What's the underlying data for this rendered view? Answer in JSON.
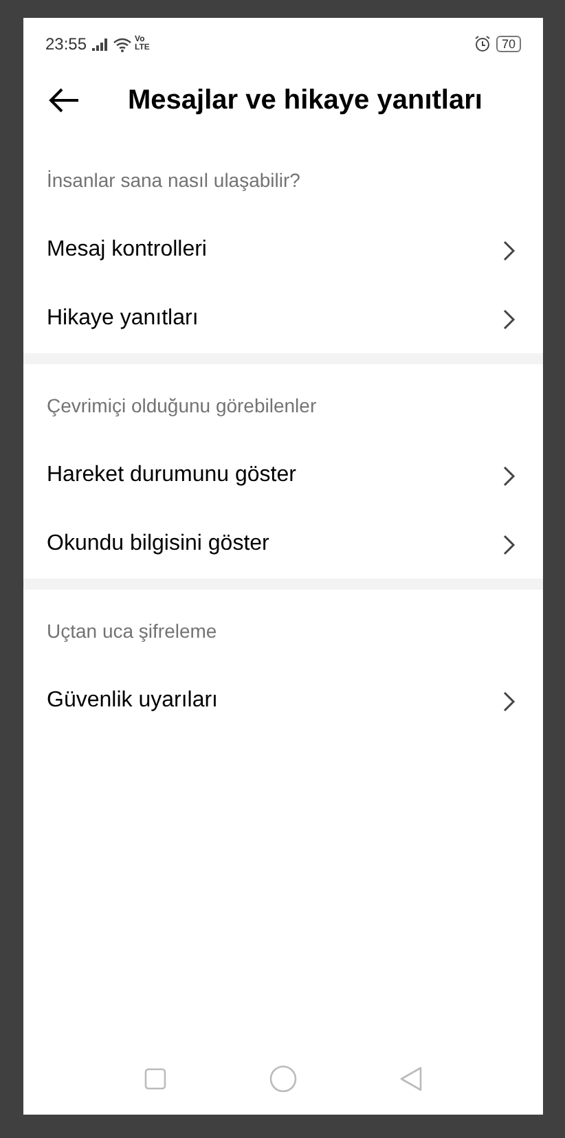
{
  "status_bar": {
    "time": "23:55",
    "network": "Vo LTE",
    "battery": "70"
  },
  "header": {
    "title": "Mesajlar ve hikaye yanıtları"
  },
  "sections": [
    {
      "title": "İnsanlar sana nasıl ulaşabilir?",
      "items": [
        "Mesaj kontrolleri",
        "Hikaye yanıtları"
      ]
    },
    {
      "title": "Çevrimiçi olduğunu görebilenler",
      "items": [
        "Hareket durumunu göster",
        "Okundu bilgisini göster"
      ]
    },
    {
      "title": "Uçtan uca şifreleme",
      "items": [
        "Güvenlik uyarıları"
      ]
    }
  ]
}
